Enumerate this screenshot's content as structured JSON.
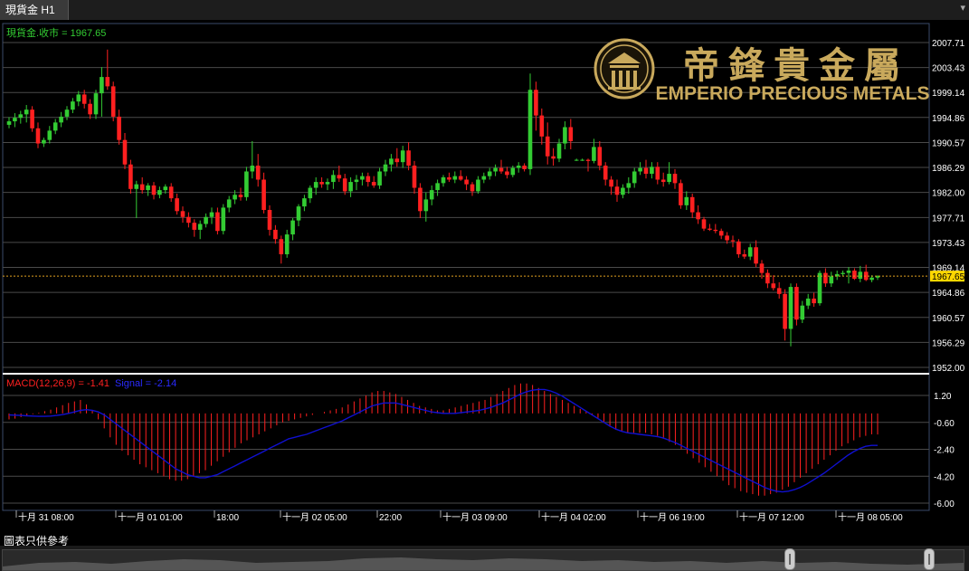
{
  "tab": {
    "title": "現貨金 H1"
  },
  "window": {
    "button": "▾"
  },
  "price_panel": {
    "legend": "現貨金.收市 = 1967.65",
    "current_price_tag": "1967.65",
    "y_ticks": [
      "2007.71",
      "2003.43",
      "1999.14",
      "1994.86",
      "1990.57",
      "1986.29",
      "1982.00",
      "1977.71",
      "1973.43",
      "1969.14",
      "1964.86",
      "1960.57",
      "1956.29",
      "1952.00"
    ]
  },
  "macd_panel": {
    "legend_macd": "MACD(12,26,9) = -1.41",
    "legend_signal": "Signal = -2.14",
    "y_ticks": [
      "1.20",
      "-0.60",
      "-2.40",
      "-4.20",
      "-6.00"
    ]
  },
  "x_axis": {
    "ticks": [
      "十月 31 08:00",
      "十一月 01 01:00",
      "18:00",
      "十一月 02 05:00",
      "22:00",
      "十一月 03 09:00",
      "十一月 04 02:00",
      "十一月 06 19:00",
      "十一月 07 12:00",
      "十一月 08 05:00"
    ]
  },
  "logo": {
    "chinese": "帝鋒貴金屬",
    "english": "EMPERIO PRECIOUS METALS"
  },
  "footer": {
    "note": "圖表只供參考"
  },
  "colors": {
    "up": "#33cc33",
    "down": "#ff2020",
    "signal": "#1010d0",
    "axis_text": "#ffffff",
    "price_tag": "#ffd700",
    "logo": "#c9a95c"
  },
  "chart_data": [
    {
      "type": "candlestick",
      "title": "現貨金 H1",
      "ylim": [
        1952.0,
        2008.5
      ],
      "series_name": "現貨金.收市",
      "last_close": 1967.65,
      "candles_ohlc": [
        [
          1993.6,
          1994.9,
          1993.0,
          1994.2
        ],
        [
          1994.2,
          1995.6,
          1993.2,
          1994.8
        ],
        [
          1994.8,
          1996.0,
          1993.8,
          1995.4
        ],
        [
          1995.4,
          1997.0,
          1994.0,
          1996.2
        ],
        [
          1996.2,
          1996.8,
          1992.4,
          1993.0
        ],
        [
          1993.0,
          1994.0,
          1989.6,
          1990.4
        ],
        [
          1990.4,
          1991.4,
          1989.8,
          1991.0
        ],
        [
          1991.0,
          1993.4,
          1990.4,
          1992.6
        ],
        [
          1992.6,
          1994.6,
          1992.0,
          1994.0
        ],
        [
          1994.0,
          1995.8,
          1993.2,
          1995.0
        ],
        [
          1995.0,
          1996.8,
          1994.4,
          1996.2
        ],
        [
          1996.2,
          1998.2,
          1995.6,
          1997.6
        ],
        [
          1997.6,
          1999.4,
          1996.8,
          1998.8
        ],
        [
          1998.8,
          1999.6,
          1996.4,
          1997.2
        ],
        [
          1997.2,
          1998.0,
          1994.6,
          1995.4
        ],
        [
          1995.4,
          1999.6,
          1994.6,
          1999.0
        ],
        [
          1999.0,
          2003.5,
          1995.0,
          2001.8
        ],
        [
          2001.8,
          2006.5,
          1999.6,
          2000.2
        ],
        [
          2000.2,
          2001.0,
          1994.2,
          1995.0
        ],
        [
          1995.0,
          1996.2,
          1990.2,
          1991.0
        ],
        [
          1991.0,
          1992.2,
          1986.0,
          1986.8
        ],
        [
          1986.8,
          1987.6,
          1981.8,
          1982.6
        ],
        [
          1982.6,
          1984.0,
          1977.6,
          1983.4
        ],
        [
          1983.4,
          1984.6,
          1981.8,
          1982.4
        ],
        [
          1982.4,
          1983.6,
          1981.4,
          1983.2
        ],
        [
          1983.2,
          1983.8,
          1980.8,
          1981.6
        ],
        [
          1981.6,
          1983.0,
          1981.0,
          1982.4
        ],
        [
          1982.4,
          1983.4,
          1981.8,
          1983.0
        ],
        [
          1983.0,
          1983.6,
          1980.4,
          1981.0
        ],
        [
          1981.0,
          1981.8,
          1978.2,
          1978.8
        ],
        [
          1978.8,
          1979.6,
          1976.8,
          1977.8
        ],
        [
          1977.8,
          1978.6,
          1976.0,
          1976.8
        ],
        [
          1976.8,
          1977.4,
          1974.4,
          1975.6
        ],
        [
          1975.6,
          1977.2,
          1974.0,
          1976.6
        ],
        [
          1976.6,
          1978.4,
          1976.0,
          1977.8
        ],
        [
          1977.8,
          1979.4,
          1976.6,
          1978.6
        ],
        [
          1978.6,
          1979.4,
          1974.8,
          1975.4
        ],
        [
          1975.4,
          1980.0,
          1974.8,
          1979.4
        ],
        [
          1979.4,
          1981.4,
          1978.6,
          1980.8
        ],
        [
          1980.8,
          1982.4,
          1980.0,
          1981.6
        ],
        [
          1981.6,
          1982.8,
          1980.6,
          1981.2
        ],
        [
          1981.2,
          1986.4,
          1980.6,
          1985.6
        ],
        [
          1985.6,
          1990.8,
          1984.4,
          1986.6
        ],
        [
          1986.6,
          1988.6,
          1983.0,
          1984.2
        ],
        [
          1984.2,
          1985.4,
          1978.4,
          1979.0
        ],
        [
          1979.0,
          1979.8,
          1974.6,
          1975.6
        ],
        [
          1975.6,
          1976.4,
          1973.2,
          1974.0
        ],
        [
          1974.0,
          1974.6,
          1969.8,
          1971.4
        ],
        [
          1971.4,
          1975.6,
          1970.8,
          1974.8
        ],
        [
          1974.8,
          1977.6,
          1973.8,
          1977.2
        ],
        [
          1977.2,
          1980.0,
          1976.2,
          1979.6
        ],
        [
          1979.6,
          1981.6,
          1978.8,
          1981.0
        ],
        [
          1981.0,
          1983.2,
          1980.2,
          1982.8
        ],
        [
          1982.8,
          1984.6,
          1981.6,
          1983.8
        ],
        [
          1983.8,
          1984.6,
          1982.8,
          1983.4
        ],
        [
          1983.4,
          1984.4,
          1982.4,
          1983.8
        ],
        [
          1983.8,
          1985.8,
          1982.6,
          1985.0
        ],
        [
          1985.0,
          1986.6,
          1983.8,
          1984.4
        ],
        [
          1984.4,
          1985.2,
          1981.6,
          1982.2
        ],
        [
          1982.2,
          1984.6,
          1981.2,
          1983.8
        ],
        [
          1983.8,
          1985.0,
          1982.4,
          1984.2
        ],
        [
          1984.2,
          1985.4,
          1983.2,
          1984.8
        ],
        [
          1984.8,
          1985.4,
          1983.0,
          1983.8
        ],
        [
          1983.8,
          1984.8,
          1982.8,
          1983.2
        ],
        [
          1983.2,
          1986.2,
          1982.6,
          1985.6
        ],
        [
          1985.6,
          1987.6,
          1984.8,
          1986.8
        ],
        [
          1986.8,
          1988.6,
          1985.6,
          1987.8
        ],
        [
          1987.8,
          1989.6,
          1986.4,
          1987.2
        ],
        [
          1987.2,
          1990.0,
          1986.2,
          1989.2
        ],
        [
          1989.2,
          1990.6,
          1985.8,
          1986.6
        ],
        [
          1986.6,
          1987.4,
          1981.8,
          1982.8
        ],
        [
          1982.8,
          1983.6,
          1977.6,
          1978.8
        ],
        [
          1978.8,
          1982.0,
          1977.0,
          1980.8
        ],
        [
          1980.8,
          1983.2,
          1979.8,
          1982.4
        ],
        [
          1982.4,
          1984.2,
          1981.4,
          1983.6
        ],
        [
          1983.6,
          1985.0,
          1983.0,
          1984.6
        ],
        [
          1984.6,
          1985.4,
          1983.8,
          1984.2
        ],
        [
          1984.2,
          1985.6,
          1983.6,
          1984.8
        ],
        [
          1984.8,
          1985.8,
          1984.0,
          1984.2
        ],
        [
          1984.2,
          1984.8,
          1982.4,
          1983.4
        ],
        [
          1983.4,
          1983.8,
          1981.4,
          1982.2
        ],
        [
          1982.2,
          1984.8,
          1981.8,
          1984.2
        ],
        [
          1984.2,
          1985.4,
          1983.6,
          1984.8
        ],
        [
          1984.8,
          1986.2,
          1984.2,
          1985.6
        ],
        [
          1985.6,
          1986.8,
          1984.8,
          1986.2
        ],
        [
          1986.2,
          1987.6,
          1985.2,
          1985.6
        ],
        [
          1985.6,
          1986.4,
          1984.4,
          1985.0
        ],
        [
          1985.0,
          1986.6,
          1984.6,
          1986.2
        ],
        [
          1986.2,
          1987.2,
          1985.4,
          1986.6
        ],
        [
          1986.6,
          1987.0,
          1985.6,
          1986.0
        ],
        [
          1986.0,
          2002.4,
          1985.0,
          1999.6
        ],
        [
          1999.6,
          2001.0,
          1992.6,
          1995.2
        ],
        [
          1995.2,
          1996.4,
          1990.2,
          1991.6
        ],
        [
          1991.6,
          1994.0,
          1986.8,
          1988.2
        ],
        [
          1988.2,
          1989.6,
          1986.6,
          1987.8
        ],
        [
          1987.8,
          1991.2,
          1987.2,
          1990.4
        ],
        [
          1990.4,
          1994.2,
          1989.4,
          1993.2
        ],
        [
          1993.2,
          1994.6,
          1989.4,
          1990.8
        ],
        [
          1987.6,
          1987.8,
          1987.4,
          1987.6
        ],
        [
          1987.6,
          1987.8,
          1987.4,
          1987.6
        ],
        [
          1987.6,
          1987.8,
          1985.6,
          1987.4
        ],
        [
          1987.4,
          1991.2,
          1987.0,
          1989.8
        ],
        [
          1989.8,
          1990.8,
          1985.8,
          1986.6
        ],
        [
          1986.6,
          1987.2,
          1983.2,
          1984.2
        ],
        [
          1984.2,
          1984.8,
          1981.6,
          1983.0
        ],
        [
          1983.0,
          1984.2,
          1980.4,
          1981.6
        ],
        [
          1981.6,
          1983.4,
          1981.0,
          1982.8
        ],
        [
          1982.8,
          1984.6,
          1981.8,
          1983.6
        ],
        [
          1983.6,
          1986.2,
          1982.8,
          1985.6
        ],
        [
          1985.6,
          1987.2,
          1985.0,
          1986.2
        ],
        [
          1986.2,
          1987.6,
          1984.4,
          1985.2
        ],
        [
          1985.2,
          1987.2,
          1984.4,
          1986.4
        ],
        [
          1986.4,
          1987.2,
          1983.4,
          1984.2
        ],
        [
          1984.2,
          1985.4,
          1983.0,
          1983.8
        ],
        [
          1983.8,
          1987.2,
          1983.4,
          1985.2
        ],
        [
          1985.2,
          1986.0,
          1982.6,
          1983.6
        ],
        [
          1983.6,
          1984.2,
          1979.2,
          1979.8
        ],
        [
          1979.8,
          1982.2,
          1979.0,
          1981.2
        ],
        [
          1981.2,
          1981.8,
          1977.6,
          1978.6
        ],
        [
          1978.6,
          1979.8,
          1976.6,
          1977.4
        ],
        [
          1977.4,
          1977.8,
          1975.4,
          1975.8
        ],
        [
          1975.8,
          1976.6,
          1975.4,
          1975.6
        ],
        [
          1975.6,
          1976.6,
          1975.0,
          1975.4
        ],
        [
          1975.4,
          1975.8,
          1974.0,
          1974.6
        ],
        [
          1974.6,
          1975.2,
          1973.2,
          1973.8
        ],
        [
          1973.8,
          1974.6,
          1972.6,
          1973.6
        ],
        [
          1973.6,
          1974.0,
          1970.8,
          1971.4
        ],
        [
          1971.4,
          1972.2,
          1970.6,
          1971.0
        ],
        [
          1971.0,
          1973.2,
          1970.4,
          1972.6
        ],
        [
          1972.6,
          1973.8,
          1969.2,
          1969.8
        ],
        [
          1969.8,
          1970.4,
          1967.2,
          1968.2
        ],
        [
          1968.2,
          1968.8,
          1965.6,
          1966.4
        ],
        [
          1966.4,
          1967.8,
          1965.2,
          1965.6
        ],
        [
          1965.6,
          1966.6,
          1963.8,
          1964.6
        ],
        [
          1964.6,
          1965.4,
          1956.6,
          1958.6
        ],
        [
          1958.6,
          1966.4,
          1955.6,
          1965.8
        ],
        [
          1965.8,
          1966.4,
          1959.2,
          1960.2
        ],
        [
          1960.2,
          1963.4,
          1959.6,
          1962.6
        ],
        [
          1962.6,
          1964.6,
          1962.0,
          1963.8
        ],
        [
          1963.8,
          1964.8,
          1962.4,
          1963.0
        ],
        [
          1963.0,
          1968.6,
          1962.6,
          1968.2
        ],
        [
          1968.2,
          1969.0,
          1965.8,
          1966.4
        ],
        [
          1966.4,
          1968.4,
          1965.8,
          1967.6
        ],
        [
          1967.6,
          1968.6,
          1967.0,
          1968.0
        ],
        [
          1968.0,
          1968.6,
          1967.6,
          1968.2
        ],
        [
          1968.2,
          1969.2,
          1966.4,
          1968.6
        ],
        [
          1968.6,
          1969.0,
          1967.0,
          1967.2
        ],
        [
          1967.2,
          1969.4,
          1966.6,
          1968.4
        ],
        [
          1968.4,
          1969.6,
          1966.8,
          1967.0
        ],
        [
          1967.0,
          1967.8,
          1966.6,
          1967.4
        ],
        [
          1967.4,
          1967.8,
          1967.0,
          1967.65
        ]
      ]
    },
    {
      "type": "bar",
      "title": "MACD(12,26,9)",
      "ylim": [
        -6.3,
        2.0
      ],
      "macd_last": -1.41,
      "signal_last": -2.14,
      "macd_histogram": [
        -0.4,
        -0.35,
        -0.25,
        -0.15,
        -0.05,
        0.05,
        0.15,
        0.25,
        0.4,
        0.55,
        0.7,
        0.8,
        0.9,
        0.6,
        0.2,
        -0.4,
        -1.0,
        -1.6,
        -2.1,
        -2.5,
        -2.8,
        -3.1,
        -3.4,
        -3.6,
        -3.8,
        -4.0,
        -4.2,
        -4.4,
        -4.5,
        -4.5,
        -4.4,
        -4.2,
        -4.0,
        -3.8,
        -3.5,
        -3.2,
        -2.9,
        -2.6,
        -2.3,
        -2.0,
        -1.8,
        -1.6,
        -1.4,
        -1.2,
        -1.0,
        -0.8,
        -0.6,
        -0.5,
        -0.4,
        -0.3,
        -0.2,
        -0.1,
        0.0,
        0.1,
        0.2,
        0.3,
        0.4,
        0.6,
        0.8,
        1.0,
        1.2,
        1.4,
        1.5,
        1.5,
        1.4,
        1.3,
        1.1,
        0.9,
        0.7,
        0.5,
        0.4,
        0.3,
        0.2,
        0.2,
        0.3,
        0.4,
        0.5,
        0.6,
        0.7,
        0.8,
        0.9,
        1.1,
        1.3,
        1.5,
        1.7,
        1.9,
        2.0,
        2.0,
        1.9,
        1.7,
        1.5,
        1.3,
        1.1,
        0.9,
        0.7,
        0.5,
        0.3,
        0.1,
        -0.1,
        -0.3,
        -0.6,
        -0.9,
        -1.1,
        -1.2,
        -1.3,
        -1.3,
        -1.3,
        -1.3,
        -1.4,
        -1.5,
        -1.7,
        -1.9,
        -2.1,
        -2.4,
        -2.7,
        -3.0,
        -3.3,
        -3.6,
        -3.9,
        -4.2,
        -4.5,
        -4.8,
        -5.0,
        -5.2,
        -5.3,
        -5.4,
        -5.5,
        -5.5,
        -5.4,
        -5.3,
        -5.1,
        -4.9,
        -4.6,
        -4.3,
        -4.0,
        -3.7,
        -3.4,
        -3.1,
        -2.8,
        -2.5,
        -2.2,
        -2.0,
        -1.8,
        -1.6,
        -1.5,
        -1.4,
        -1.41
      ],
      "signal_line": [
        -0.1,
        -0.12,
        -0.14,
        -0.16,
        -0.18,
        -0.2,
        -0.2,
        -0.18,
        -0.14,
        -0.08,
        0.0,
        0.1,
        0.2,
        0.25,
        0.2,
        0.1,
        -0.1,
        -0.4,
        -0.7,
        -1.0,
        -1.3,
        -1.6,
        -1.9,
        -2.2,
        -2.5,
        -2.8,
        -3.1,
        -3.4,
        -3.7,
        -3.9,
        -4.1,
        -4.2,
        -4.3,
        -4.3,
        -4.2,
        -4.1,
        -3.9,
        -3.7,
        -3.5,
        -3.3,
        -3.1,
        -2.9,
        -2.7,
        -2.5,
        -2.3,
        -2.1,
        -1.9,
        -1.7,
        -1.6,
        -1.5,
        -1.4,
        -1.25,
        -1.1,
        -0.95,
        -0.8,
        -0.65,
        -0.5,
        -0.3,
        -0.1,
        0.1,
        0.3,
        0.5,
        0.6,
        0.7,
        0.7,
        0.7,
        0.6,
        0.5,
        0.4,
        0.3,
        0.2,
        0.1,
        0.05,
        0.0,
        0.0,
        0.0,
        0.05,
        0.1,
        0.15,
        0.2,
        0.3,
        0.4,
        0.55,
        0.7,
        0.9,
        1.1,
        1.3,
        1.45,
        1.55,
        1.6,
        1.6,
        1.5,
        1.35,
        1.15,
        0.9,
        0.65,
        0.4,
        0.15,
        -0.1,
        -0.35,
        -0.6,
        -0.85,
        -1.05,
        -1.2,
        -1.3,
        -1.35,
        -1.4,
        -1.45,
        -1.5,
        -1.55,
        -1.65,
        -1.8,
        -1.95,
        -2.15,
        -2.35,
        -2.55,
        -2.75,
        -2.95,
        -3.15,
        -3.35,
        -3.55,
        -3.75,
        -3.95,
        -4.15,
        -4.35,
        -4.55,
        -4.75,
        -4.95,
        -5.1,
        -5.2,
        -5.25,
        -5.2,
        -5.1,
        -4.95,
        -4.75,
        -4.5,
        -4.25,
        -4.0,
        -3.7,
        -3.4,
        -3.1,
        -2.8,
        -2.55,
        -2.35,
        -2.2,
        -2.14,
        -2.14
      ]
    }
  ]
}
